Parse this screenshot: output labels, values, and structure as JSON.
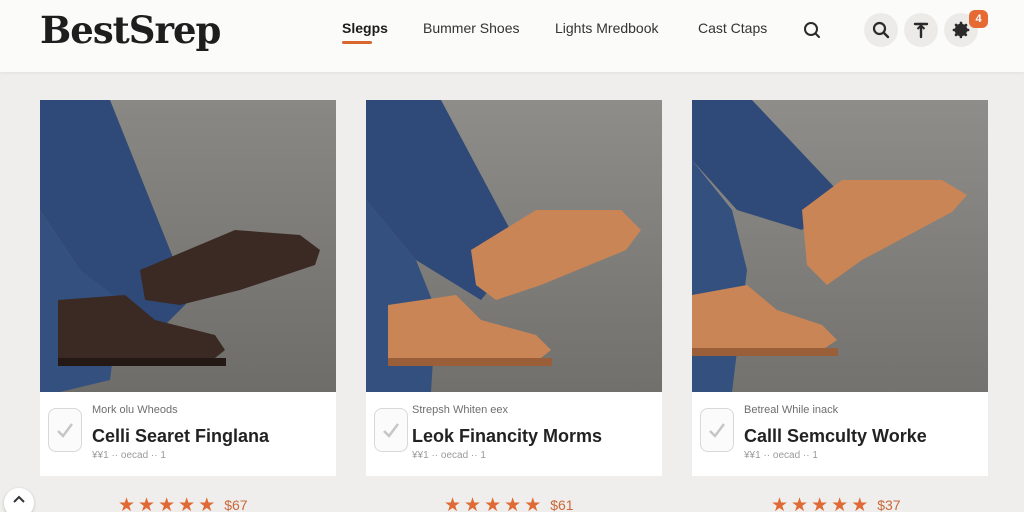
{
  "brand": {
    "logo": "BestSrep"
  },
  "nav": {
    "items": [
      {
        "label": "Slegps",
        "active": true
      },
      {
        "label": "Bummer Shoes",
        "active": false
      },
      {
        "label": "Lights Mredbook",
        "active": false
      },
      {
        "label": "Cast Ctaps",
        "active": false
      }
    ]
  },
  "header_icons": {
    "items": [
      "search-icon",
      "search-icon",
      "upload-icon",
      "gear-icon"
    ],
    "notification_count": "4"
  },
  "colors": {
    "accent": "#df6a35",
    "header_bg": "#fbfbfa",
    "page_bg": "#efeeec"
  },
  "products": [
    {
      "subtitle": "Mork olu Wheods",
      "name": "Celli Searet Finglana",
      "meta": "¥¥1 ·· oecad  ·· 1",
      "stars": 5,
      "price": "$67",
      "boot_color": "#3b2a24"
    },
    {
      "subtitle": "Strepsh Whiten eex",
      "name": "Leok Financity Morms",
      "meta": "¥¥1 ·· oecad  ·· 1",
      "stars": 5,
      "price": "$61",
      "boot_color": "#c98556"
    },
    {
      "subtitle": "Betreal While inack",
      "name": "Calll Semculty Worke",
      "meta": "¥¥1 ·· oecad  ·· 1",
      "stars": 5,
      "price": "$37",
      "boot_color": "#c98556"
    }
  ]
}
